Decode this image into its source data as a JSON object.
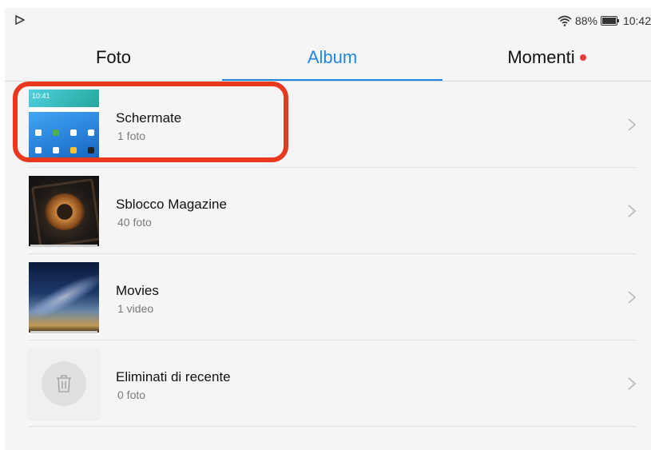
{
  "status": {
    "battery_percent": "88%",
    "time": "10:42"
  },
  "tabs": [
    {
      "label": "Foto",
      "active": false
    },
    {
      "label": "Album",
      "active": true
    },
    {
      "label": "Momenti",
      "active": false,
      "has_dot": true
    }
  ],
  "albums": [
    {
      "title": "Schermate",
      "count": "1 foto",
      "thumb": "screenshot-thumbnail"
    },
    {
      "title": "Sblocco Magazine",
      "count": "40 foto",
      "thumb": "croissant-photo-thumbnail"
    },
    {
      "title": "Movies",
      "count": "1 video",
      "thumb": "night-sky-thumbnail"
    },
    {
      "title": "Eliminati di recente",
      "count": "0 foto",
      "thumb": "trash-icon"
    }
  ],
  "screenshot_thumb_time": "10:41",
  "colors": {
    "accent": "#1e88e5",
    "dot": "#e53935",
    "highlight": "#e8391f"
  }
}
